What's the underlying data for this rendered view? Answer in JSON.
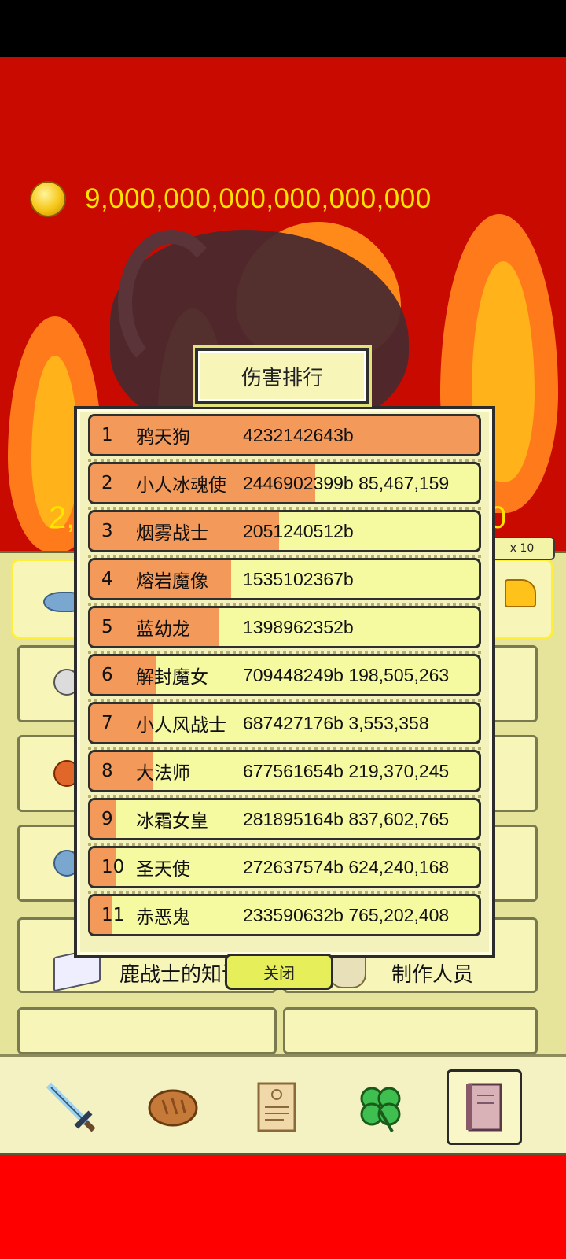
{
  "header": {
    "coin_amount": "9,000,000,000,000,000,000"
  },
  "background": {
    "partial_left": "2,",
    "partial_right": "0",
    "multiplier": "x 10"
  },
  "ranking": {
    "title": "伤害排行",
    "rows": [
      {
        "rank": "1",
        "name": "鸦天狗",
        "damage": "4232142643b",
        "extra": "",
        "fraction": 1.0
      },
      {
        "rank": "2",
        "name": "小人冰魂使",
        "damage": "2446902399b",
        "extra": "85,467,159",
        "fraction": 0.578
      },
      {
        "rank": "3",
        "name": "烟雾战士",
        "damage": "2051240512b",
        "extra": "",
        "fraction": 0.485
      },
      {
        "rank": "4",
        "name": "熔岩魔像",
        "damage": "1535102367b",
        "extra": "",
        "fraction": 0.363
      },
      {
        "rank": "5",
        "name": "蓝幼龙",
        "damage": "1398962352b",
        "extra": "",
        "fraction": 0.331
      },
      {
        "rank": "6",
        "name": "解封魔女",
        "damage": "709448249b",
        "extra": "198,505,263",
        "fraction": 0.168
      },
      {
        "rank": "7",
        "name": "小人风战士",
        "damage": "687427176b",
        "extra": "3,553,358",
        "fraction": 0.162
      },
      {
        "rank": "8",
        "name": "大法师",
        "damage": "677561654b",
        "extra": "219,370,245",
        "fraction": 0.16
      },
      {
        "rank": "9",
        "name": "冰霜女皇",
        "damage": "281895164b",
        "extra": "837,602,765",
        "fraction": 0.067
      },
      {
        "rank": "10",
        "name": "圣天使",
        "damage": "272637574b",
        "extra": "624,240,168",
        "fraction": 0.064
      },
      {
        "rank": "11",
        "name": "赤恶鬼",
        "damage": "233590632b",
        "extra": "765,202,408",
        "fraction": 0.055
      }
    ],
    "close_label": "关闭"
  },
  "menu": {
    "knowledge_label": "鹿战士的知识",
    "credits_label": "制作人员"
  },
  "nav": {
    "items": [
      {
        "name": "sword-icon"
      },
      {
        "name": "bread-icon"
      },
      {
        "name": "scroll-icon"
      },
      {
        "name": "clover-icon"
      },
      {
        "name": "book-icon",
        "active": true
      }
    ]
  },
  "colors": {
    "bar_fill": "#f39a5a",
    "row_bg": "#f5f9a0",
    "coin_text": "#ffe400",
    "scene_bg": "#c90a00"
  }
}
